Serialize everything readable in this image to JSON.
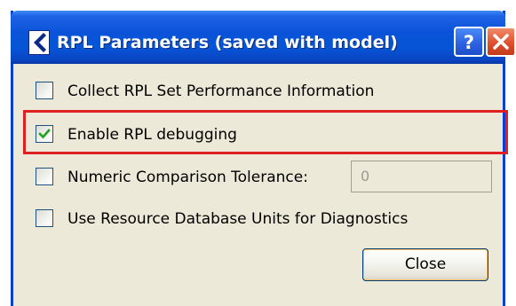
{
  "window": {
    "title": "RPL Parameters (saved with model)"
  },
  "titlebar_buttons": {
    "help_label": "?",
    "close_icon": "close-x-icon"
  },
  "options": [
    {
      "label": "Collect RPL Set Performance Information",
      "checked": false
    },
    {
      "label": "Enable RPL debugging",
      "checked": true
    },
    {
      "label": "Numeric Comparison Tolerance:",
      "checked": false
    },
    {
      "label": "Use Resource Database Units for Diagnostics",
      "checked": false
    }
  ],
  "tolerance_field": {
    "value": "0"
  },
  "close_button": {
    "label": "Close"
  },
  "colors": {
    "titlebar": "#0a53d8",
    "highlight_border": "#e02020",
    "checkmark": "#21a121",
    "dialog_bg": "#ece9d8"
  }
}
